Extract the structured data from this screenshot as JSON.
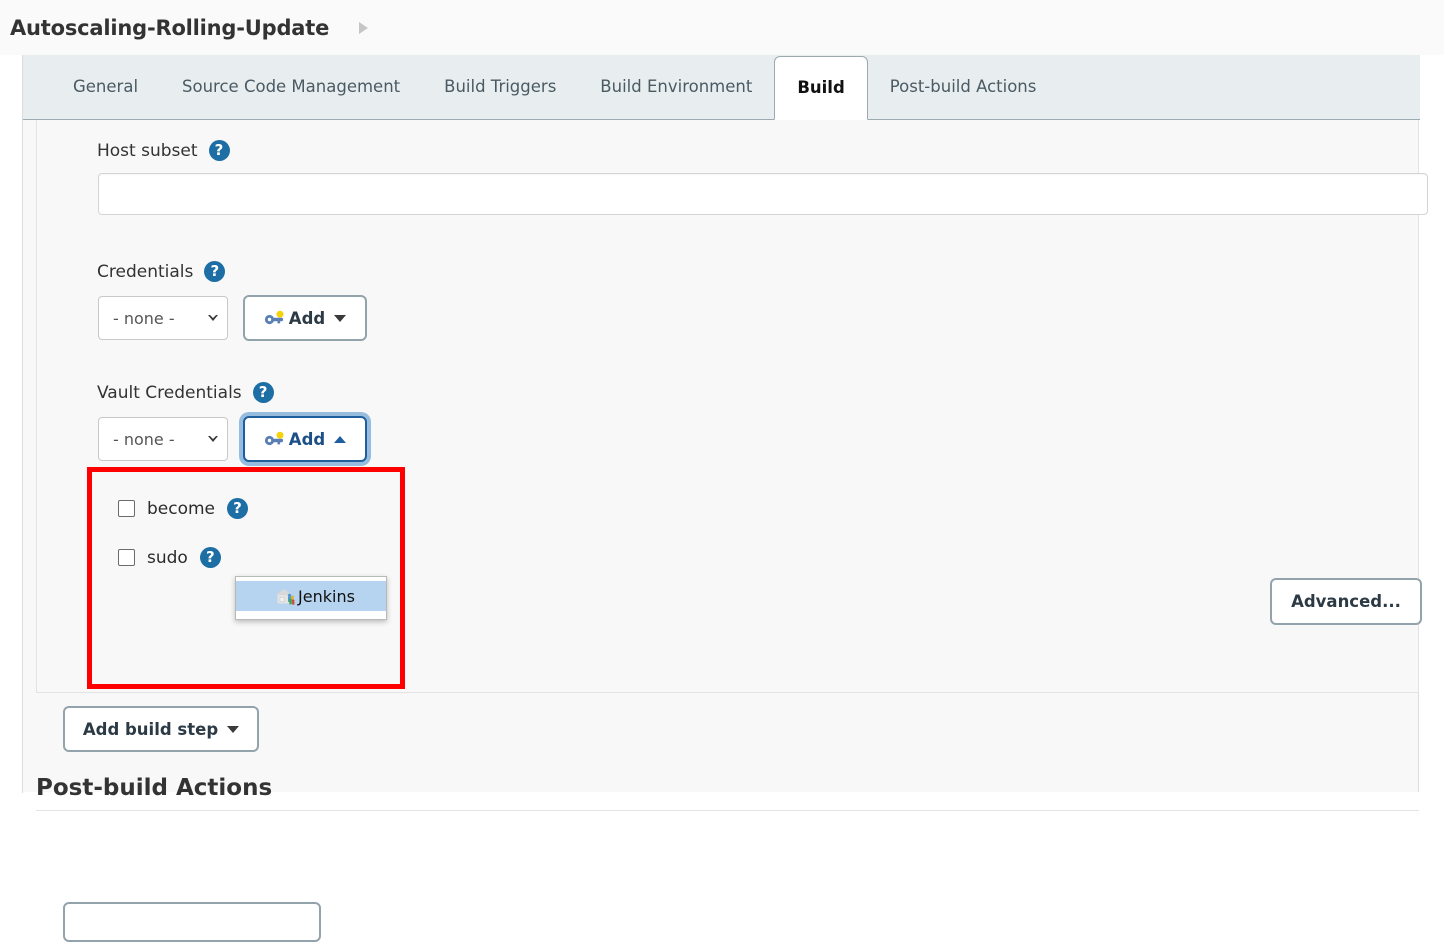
{
  "header": {
    "job_title": "Autoscaling-Rolling-Update",
    "breadcrumb_arrow": "breadcrumb-arrow-icon"
  },
  "tabs": [
    {
      "label": "General",
      "active": false
    },
    {
      "label": "Source Code Management",
      "active": false
    },
    {
      "label": "Build Triggers",
      "active": false
    },
    {
      "label": "Build Environment",
      "active": false
    },
    {
      "label": "Build",
      "active": true
    },
    {
      "label": "Post-build Actions",
      "active": false
    }
  ],
  "form": {
    "host_subset": {
      "label": "Host subset",
      "help": "?",
      "value": "",
      "placeholder": ""
    },
    "credentials": {
      "label": "Credentials",
      "help": "?",
      "selected": "- none -",
      "options": [
        "- none -"
      ],
      "add_button": "Add",
      "add_caret": "caret-down"
    },
    "vault_credentials": {
      "label": "Vault Credentials",
      "help": "?",
      "selected": "- none -",
      "options": [
        "- none -"
      ],
      "add_button": "Add",
      "add_caret": "caret-up",
      "dropdown_open": true,
      "dropdown_items": [
        "Jenkins"
      ],
      "highlighted": true,
      "highlight_color": "#ff0000"
    },
    "become": {
      "label": "become",
      "checked": false,
      "help": "?"
    },
    "sudo": {
      "label": "sudo",
      "checked": false,
      "help": "?"
    },
    "advanced_button": "Advanced..."
  },
  "actions": {
    "add_build_step": "Add build step",
    "add_build_step_caret": "caret-down"
  },
  "post_build": {
    "heading": "Post-build Actions"
  },
  "colors": {
    "accent_blue": "#1c6ea4",
    "focus_blue": "#1f5f9e",
    "highlight_red": "#ff0000",
    "tabbar_bg": "#e8eef0",
    "panel_bg": "#f8f8f8",
    "menu_highlight": "#b6d3f0"
  }
}
